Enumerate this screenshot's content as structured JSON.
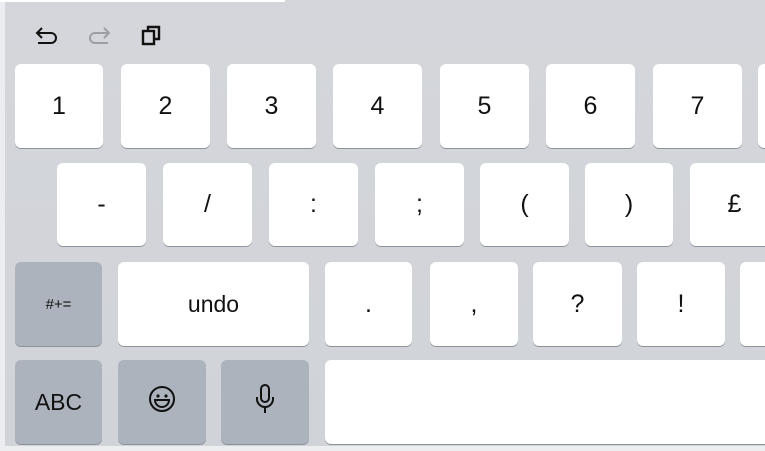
{
  "toolbar": {
    "undo_icon": "undo-arrow-icon",
    "redo_icon": "redo-arrow-icon",
    "paste_icon": "paste-clipboard-icon"
  },
  "row1": [
    "1",
    "2",
    "3",
    "4",
    "5",
    "6",
    "7"
  ],
  "row2": [
    "-",
    "/",
    ":",
    ";",
    "(",
    ")",
    "£"
  ],
  "row3": {
    "symbols_toggle": "#+=",
    "undo": "undo",
    "keys": [
      ".",
      ",",
      "?",
      "!"
    ]
  },
  "row4": {
    "abc": "ABC",
    "emoji_icon": "emoji-smiley-icon",
    "mic_icon": "microphone-icon",
    "space": ""
  },
  "colors": {
    "background": "#d2d5da",
    "key": "#ffffff",
    "function_key": "#acb3bd",
    "key_shadow": "#8e9299"
  }
}
